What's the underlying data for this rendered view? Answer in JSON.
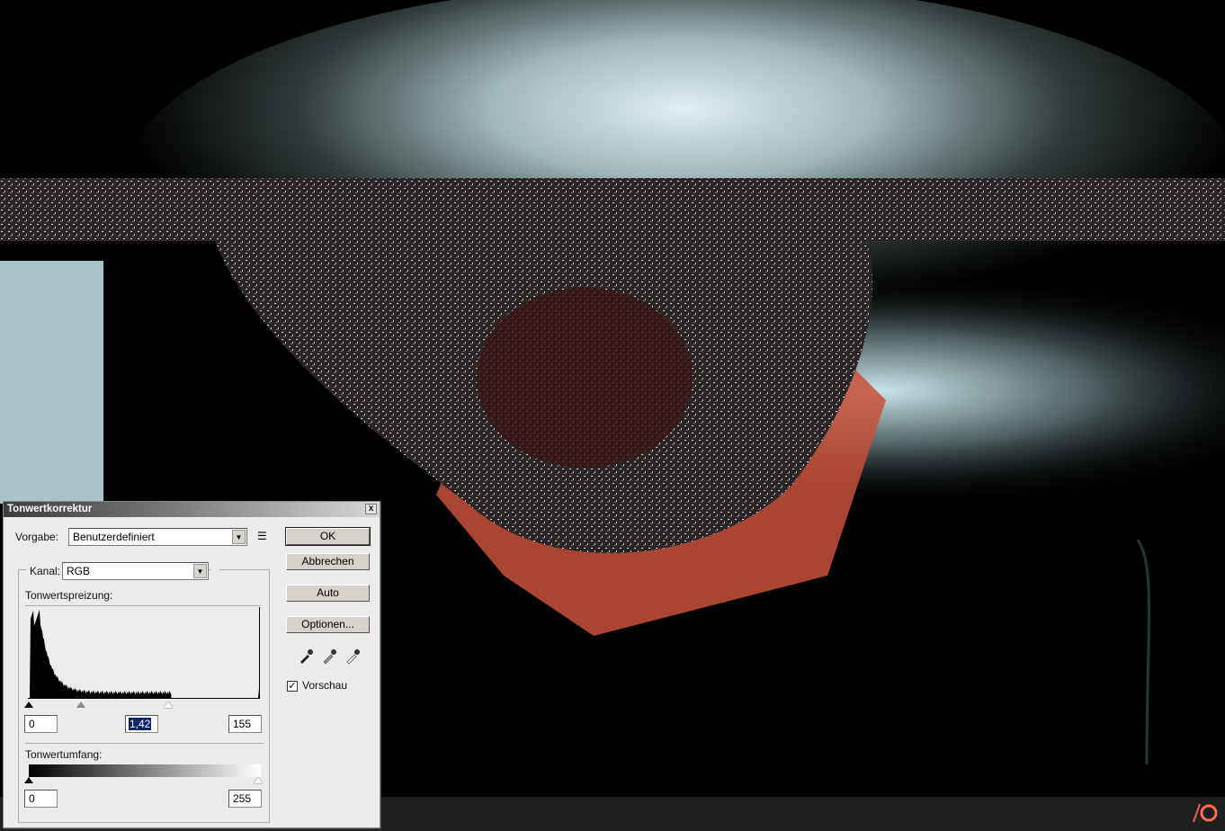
{
  "dialog": {
    "title": "Tonwertkorrektur",
    "close_label": "x",
    "preset_label": "Vorgabe:",
    "preset_value": "Benutzerdefiniert",
    "channel_label": "Kanal:",
    "channel_value": "RGB",
    "input_levels_label": "Tonwertspreizung:",
    "input_black": "0",
    "input_gamma": "1,42",
    "input_white": "155",
    "output_levels_label": "Tonwertumfang:",
    "output_black": "0",
    "output_white": "255",
    "buttons": {
      "ok": "OK",
      "cancel": "Abbrechen",
      "auto": "Auto",
      "options": "Optionen..."
    },
    "preview_label": "Vorschau",
    "preview_checked": true,
    "checkmark": "✓"
  },
  "colors": {
    "highlight": "#0a246a",
    "object_red": "#c8503c"
  }
}
